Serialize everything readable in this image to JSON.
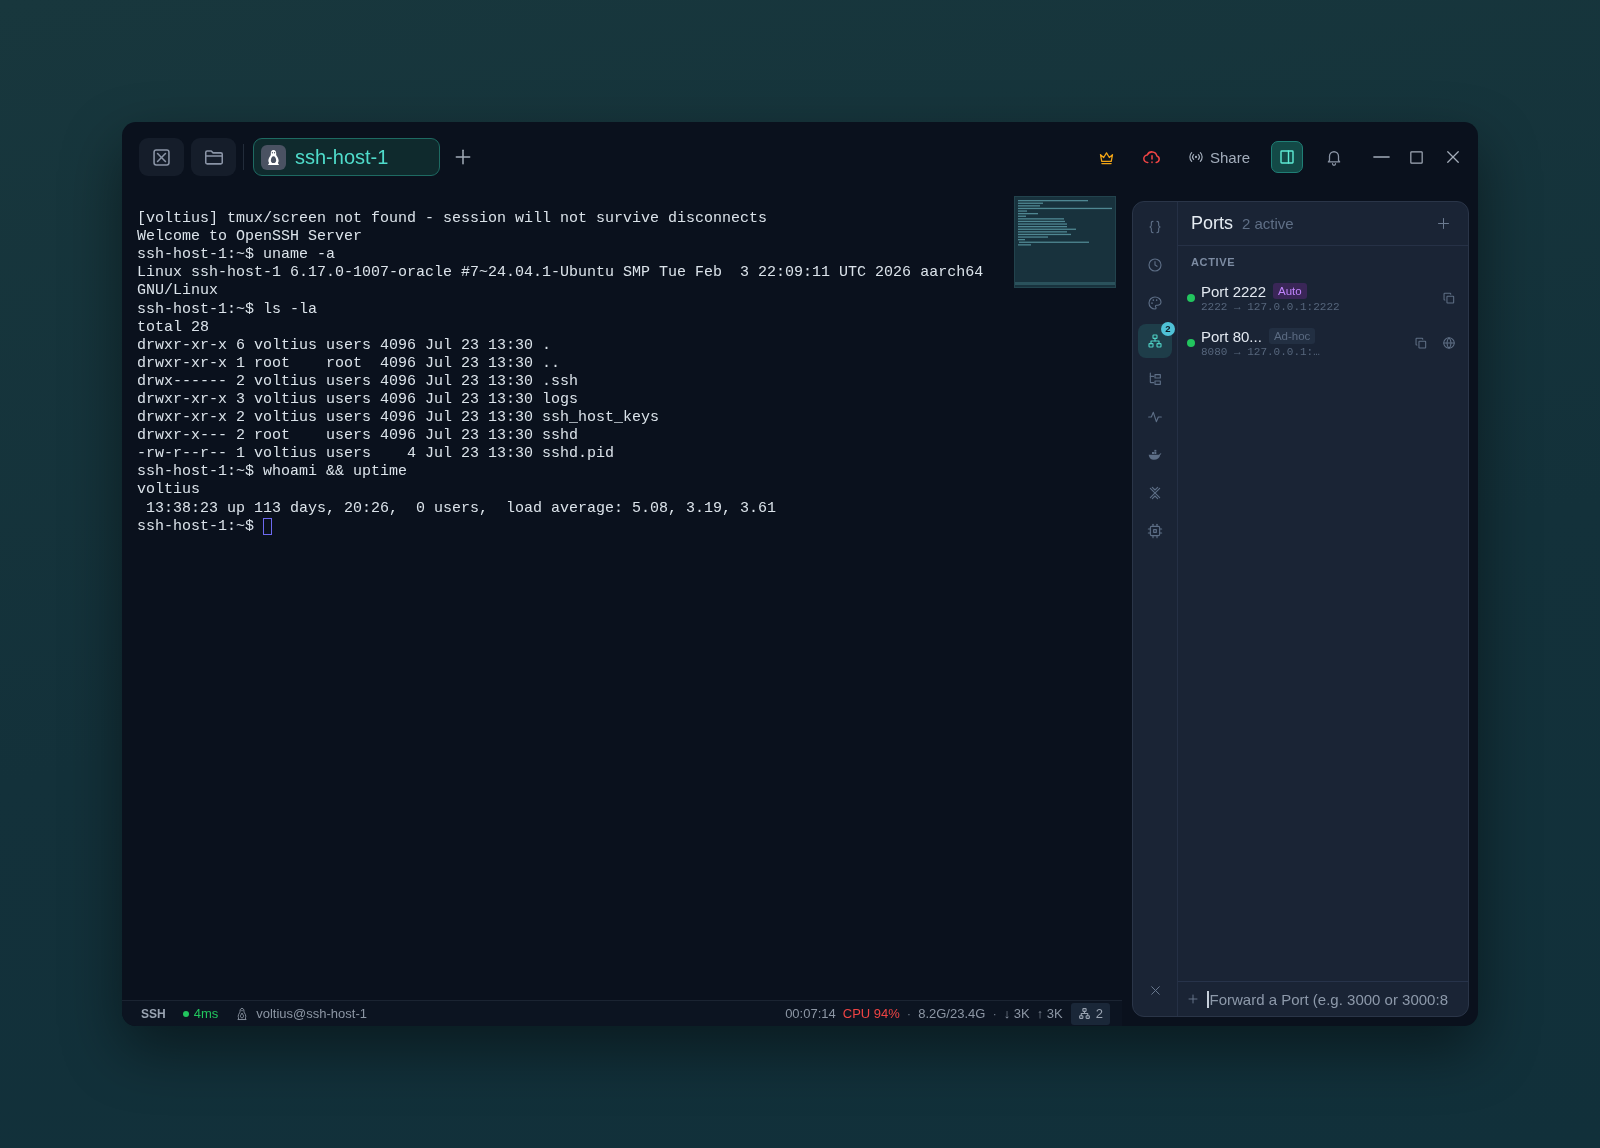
{
  "window": {
    "tabs": [
      {
        "label": "ssh-host-1",
        "selected": true
      }
    ],
    "share_label": "Share",
    "panel_toggle_on": true
  },
  "terminal": {
    "lines": [
      "[voltius] tmux/screen not found - session will not survive disconnects",
      "Welcome to OpenSSH Server",
      "ssh-host-1:~$ uname -a",
      "Linux ssh-host-1 6.17.0-1007-oracle #7~24.04.1-Ubuntu SMP Tue Feb  3 22:09:11 UTC 2026 aarch64",
      "GNU/Linux",
      "ssh-host-1:~$ ls -la",
      "total 28",
      "drwxr-xr-x 6 voltius users 4096 Jul 23 13:30 .",
      "drwxr-xr-x 1 root    root  4096 Jul 23 13:30 ..",
      "drwx------ 2 voltius users 4096 Jul 23 13:30 .ssh",
      "drwxr-xr-x 3 voltius users 4096 Jul 23 13:30 logs",
      "drwxr-xr-x 2 voltius users 4096 Jul 23 13:30 ssh_host_keys",
      "drwxr-x--- 2 root    users 4096 Jul 23 13:30 sshd",
      "-rw-r--r-- 1 voltius users    4 Jul 23 13:30 sshd.pid",
      "ssh-host-1:~$ whoami && uptime",
      "voltius",
      " 13:38:23 up 113 days, 20:26,  0 users,  load average: 5.08, 3.19, 3.61",
      "ssh-host-1:~$"
    ],
    "cursor": true
  },
  "side_panel": {
    "tools": [
      {
        "selected": false
      },
      {
        "selected": false
      },
      {
        "selected": false
      },
      {
        "selected": true,
        "badge": "2"
      },
      {
        "selected": false
      },
      {
        "selected": false
      },
      {
        "selected": false
      },
      {
        "selected": false
      },
      {
        "selected": false
      }
    ],
    "title": "Ports",
    "count": "2 active",
    "section": "ACTIVE",
    "ports": [
      {
        "name": "Port 2222",
        "tag": "Auto",
        "kind": "auto",
        "mapping": "2222 → 127.0.0.1:2222",
        "online": true,
        "browser_button": false
      },
      {
        "name": "Port 80...",
        "tag": "Ad-hoc",
        "kind": "adhoc",
        "mapping": "8080 → 127.0.0.1:…",
        "online": true,
        "browser_button": true
      }
    ],
    "input": {
      "placeholder": "Forward a Port (e.g. 3000 or 3000:8",
      "focused": true
    }
  },
  "status_bar": {
    "left": [
      {
        "kind": "protocol",
        "text": "SSH"
      },
      {
        "kind": "latency",
        "text": "4ms"
      },
      {
        "kind": "user",
        "text": "voltius@ssh-host-1"
      }
    ],
    "right": [
      {
        "kind": "metric",
        "text": "00:07:14",
        "alert": false
      },
      {
        "kind": "metric",
        "text": "CPU 94%",
        "alert": true
      },
      {
        "kind": "separator",
        "text": "·"
      },
      {
        "kind": "metric",
        "text": "8.2G/23.4G",
        "alert": false
      },
      {
        "kind": "separator",
        "text": "·"
      },
      {
        "kind": "metric",
        "text": "↓ 3K",
        "alert": false
      },
      {
        "kind": "metric",
        "text": "↑ 3K",
        "alert": false
      },
      {
        "kind": "ports",
        "text": "2"
      }
    ]
  }
}
